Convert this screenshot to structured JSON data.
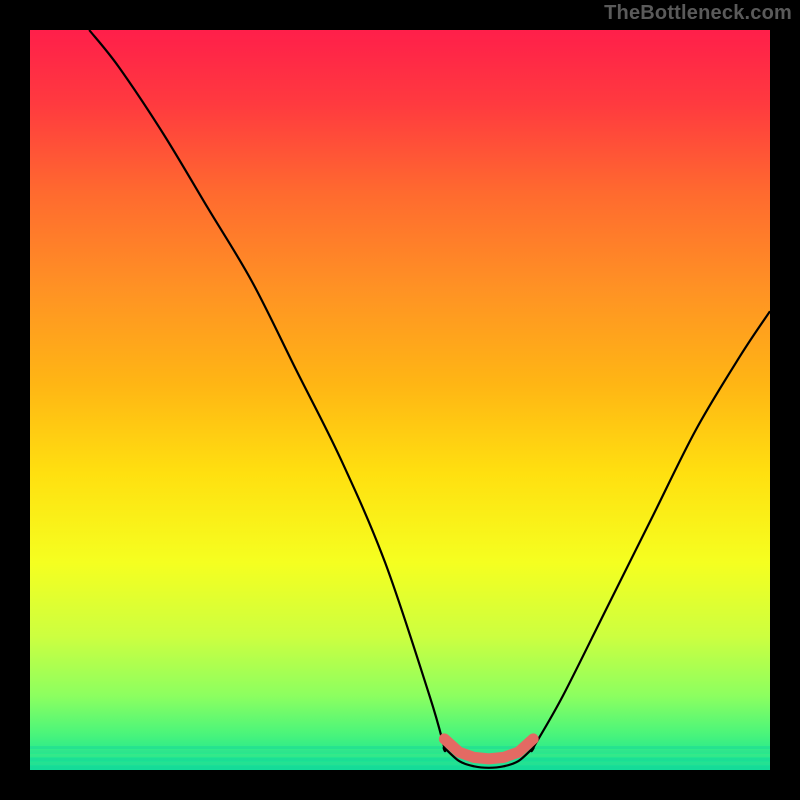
{
  "watermark": "TheBottleneck.com",
  "colors": {
    "frame": "#000000",
    "curve": "#000000",
    "dots": "#e36a63",
    "gradient": [
      {
        "offset": 0.0,
        "color": "#ff1f4a"
      },
      {
        "offset": 0.1,
        "color": "#ff3a3f"
      },
      {
        "offset": 0.22,
        "color": "#ff6a2f"
      },
      {
        "offset": 0.35,
        "color": "#ff9224"
      },
      {
        "offset": 0.48,
        "color": "#ffb614"
      },
      {
        "offset": 0.6,
        "color": "#ffe010"
      },
      {
        "offset": 0.72,
        "color": "#f5ff20"
      },
      {
        "offset": 0.82,
        "color": "#ccff40"
      },
      {
        "offset": 0.9,
        "color": "#8cff60"
      },
      {
        "offset": 0.95,
        "color": "#4cf57a"
      },
      {
        "offset": 0.98,
        "color": "#25e88e"
      },
      {
        "offset": 1.0,
        "color": "#12dd9a"
      }
    ]
  },
  "chart_data": {
    "type": "line",
    "title": "",
    "xlabel": "",
    "ylabel": "",
    "xlim": [
      0,
      100
    ],
    "ylim": [
      0,
      100
    ],
    "grid": false,
    "series": [
      {
        "name": "left-arm",
        "x": [
          8,
          12,
          18,
          24,
          30,
          36,
          42,
          48,
          54,
          56
        ],
        "y": [
          100,
          95,
          86,
          76,
          66,
          54,
          42,
          28,
          10,
          3
        ]
      },
      {
        "name": "valley",
        "x": [
          56,
          58,
          60,
          62,
          64,
          66,
          68
        ],
        "y": [
          3,
          1.2,
          0.5,
          0.3,
          0.5,
          1.2,
          3
        ]
      },
      {
        "name": "right-arm",
        "x": [
          68,
          72,
          78,
          84,
          90,
          96,
          100
        ],
        "y": [
          3,
          10,
          22,
          34,
          46,
          56,
          62
        ]
      }
    ],
    "highlight_dots": {
      "x_range": [
        56,
        68
      ],
      "y": 2,
      "count": 9,
      "color": "#e36a63"
    },
    "background_gradient": "vertical red→yellow→green"
  }
}
